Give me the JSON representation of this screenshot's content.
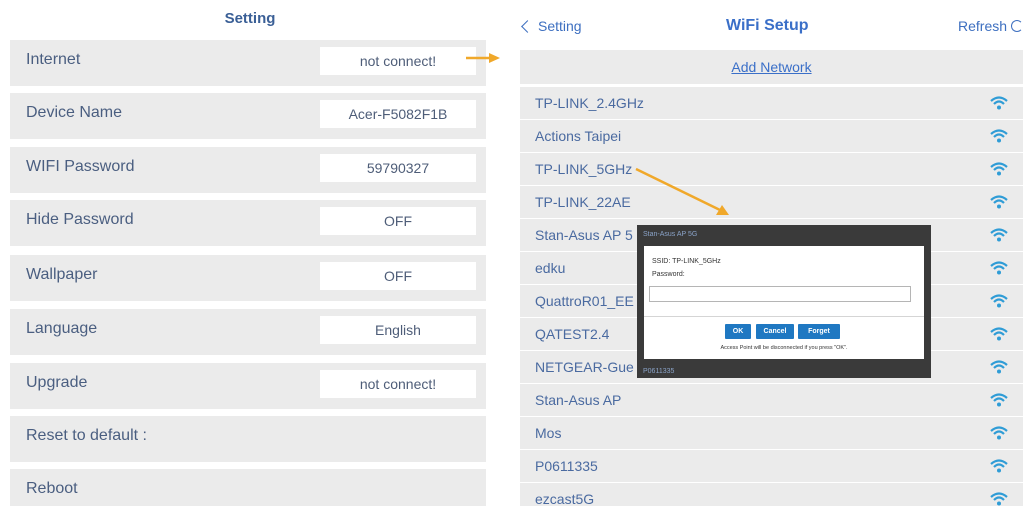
{
  "settings": {
    "title": "Setting",
    "rows": [
      {
        "label": "Internet",
        "value": "not connect!"
      },
      {
        "label": "Device Name",
        "value": "Acer-F5082F1B"
      },
      {
        "label": "WIFI Password",
        "value": "59790327"
      },
      {
        "label": "Hide Password",
        "value": "OFF"
      },
      {
        "label": "Wallpaper",
        "value": "OFF"
      },
      {
        "label": "Language",
        "value": "English"
      },
      {
        "label": "Upgrade",
        "value": "not connect!"
      },
      {
        "label": "Reset to default :"
      },
      {
        "label": "Reboot"
      }
    ]
  },
  "wifi_setup": {
    "back_label": "Setting",
    "title": "WiFi Setup",
    "refresh_label": "Refresh",
    "add_network": "Add Network",
    "networks": [
      "TP-LINK_2.4GHz",
      "Actions Taipei",
      "TP-LINK_5GHz",
      "TP-LINK_22AE",
      "Stan-Asus AP 5",
      "edku",
      "QuattroR01_EE",
      "QATEST2.4",
      "NETGEAR-Gue",
      "Stan-Asus AP",
      "Mos",
      "P0611335",
      "ezcast5G"
    ],
    "wifi_icon": "wifi-signal-icon",
    "accent_color": "#3a6fc8"
  },
  "dialog": {
    "header_text": "Stan-Asus AP 5G",
    "footer_text": "P0611335",
    "ssid_text": "SSID: TP-LINK_5GHz",
    "password_label": "Password:",
    "ok_label": "OK",
    "cancel_label": "Cancel",
    "forget_label": "Forget",
    "note": "Access Point will be disconnected if you press \"OK\".",
    "button_color": "#1f78c2"
  },
  "annotation_color": "#f0a82a"
}
